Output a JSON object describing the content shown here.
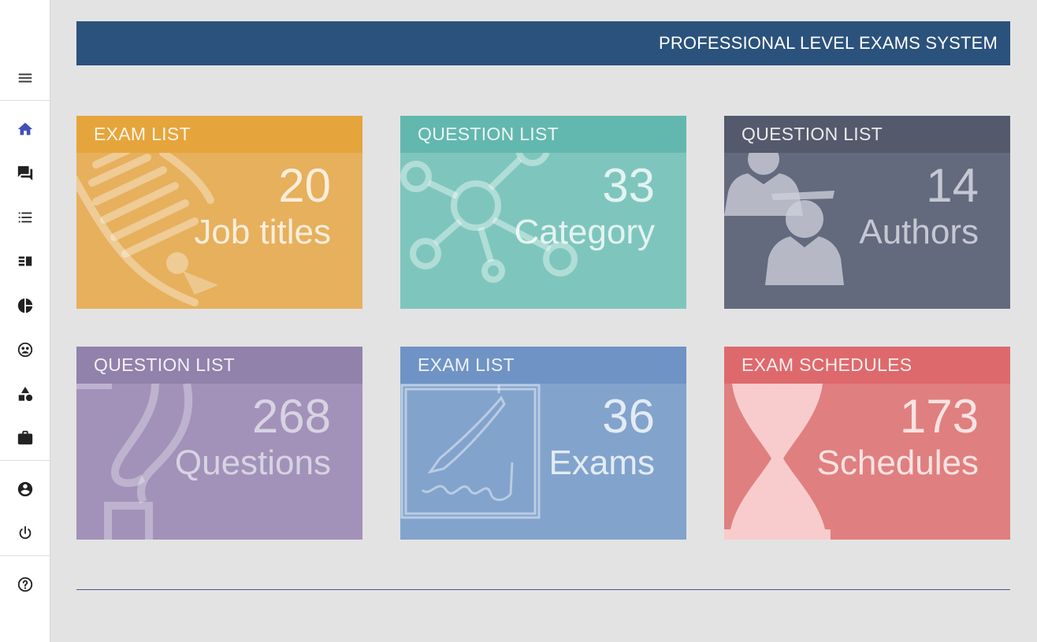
{
  "header": {
    "title": "PROFESSIONAL LEVEL EXAMS SYSTEM"
  },
  "sidebar": {
    "items": [
      {
        "icon": "menu-icon",
        "label": "Menu"
      },
      {
        "icon": "home-icon",
        "label": "Home",
        "active": true
      },
      {
        "icon": "forum-icon",
        "label": "Discussions"
      },
      {
        "icon": "list-icon",
        "label": "List"
      },
      {
        "icon": "view-list-icon",
        "label": "View list"
      },
      {
        "icon": "pie-chart-icon",
        "label": "Reports"
      },
      {
        "icon": "group-icon",
        "label": "Groups"
      },
      {
        "icon": "category-icon",
        "label": "Categories"
      },
      {
        "icon": "briefcase-icon",
        "label": "Jobs"
      },
      {
        "icon": "account-icon",
        "label": "Account"
      },
      {
        "icon": "power-icon",
        "label": "Logout"
      },
      {
        "icon": "help-icon",
        "label": "Help"
      }
    ]
  },
  "cards": [
    {
      "band": "EXAM LIST",
      "value": "20",
      "caption": "Job titles",
      "icon": "certificate-icon",
      "color": "#e6b05d",
      "band_color": "#e5a53c"
    },
    {
      "band": "QUESTION LIST",
      "value": "33",
      "caption": "Category",
      "icon": "network-icon",
      "color": "#7ec6bd",
      "band_color": "#62b8ae"
    },
    {
      "band": "QUESTION LIST",
      "value": "14",
      "caption": "Authors",
      "icon": "users-icon",
      "color": "#636a7d",
      "band_color": "#545a6c"
    },
    {
      "band": "QUESTION LIST",
      "value": "268",
      "caption": "Questions",
      "icon": "question-mark-icon",
      "color": "#a292b9",
      "band_color": "#9082ab"
    },
    {
      "band": "EXAM LIST",
      "value": "36",
      "caption": "Exams",
      "icon": "pen-icon",
      "color": "#82a3cc",
      "band_color": "#6f93c4"
    },
    {
      "band": "EXAM SCHEDULES",
      "value": "173",
      "caption": "Schedules",
      "icon": "hourglass-icon",
      "color": "#e07f7f",
      "band_color": "#de696c"
    }
  ],
  "colors": {
    "accent": "#3f51b5",
    "header_bg": "#2b527c",
    "page_bg": "#e3e3e3"
  }
}
